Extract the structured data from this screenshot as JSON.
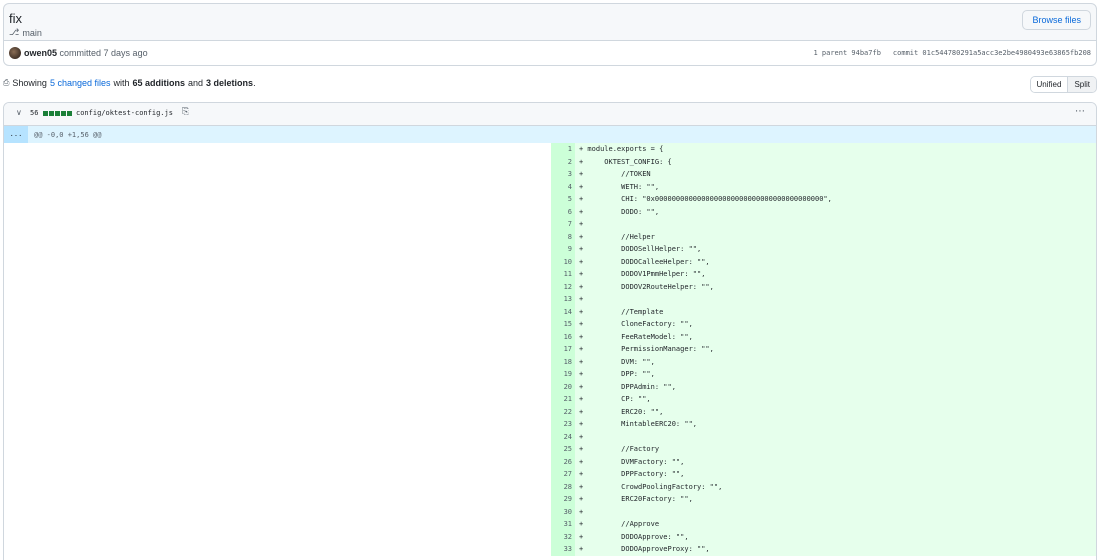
{
  "commit": {
    "title": "fix",
    "branch": "main",
    "browse_label": "Browse files",
    "author": "owen05",
    "committed_text": "committed 7 days ago",
    "parent_text": "1 parent 94ba7fb",
    "commit_text": "commit 01c544780291a5acc3e2be4980493e63865fb208"
  },
  "summary": {
    "showing": "Showing",
    "changed_files": "5 changed files",
    "with": "with",
    "additions": "65 additions",
    "and": "and",
    "deletions": "3 deletions",
    "period": "."
  },
  "view_toggle": {
    "unified": "Unified",
    "split": "Split"
  },
  "file": {
    "count": "56",
    "name": "config/oktest-config.js",
    "expand_label": "...",
    "hunk": "@@ -0,0 +1,56 @@"
  },
  "icons": {
    "branch": "git-branch-icon",
    "file_diff": "file-diff-icon",
    "chevron": "chevron-down-icon",
    "copy": "copy-icon",
    "kebab": "kebab-horizontal-icon"
  },
  "colors": {
    "link": "#0969da",
    "addition_bg": "#e6ffec",
    "addition_num_bg": "#ccffd8",
    "hunk_bg": "#ddf4ff"
  },
  "lines": [
    {
      "n": "1",
      "c": "+ module.exports = {"
    },
    {
      "n": "2",
      "c": "+     OKTEST_CONFIG: {"
    },
    {
      "n": "3",
      "c": "+         //TOKEN"
    },
    {
      "n": "4",
      "c": "+         WETH: \"\","
    },
    {
      "n": "5",
      "c": "+         CHI: \"0x0000000000000000000000000000000000000000\","
    },
    {
      "n": "6",
      "c": "+         DODO: \"\","
    },
    {
      "n": "7",
      "c": "+"
    },
    {
      "n": "8",
      "c": "+         //Helper"
    },
    {
      "n": "9",
      "c": "+         DODOSellHelper: \"\","
    },
    {
      "n": "10",
      "c": "+         DODOCalleeHelper: \"\","
    },
    {
      "n": "11",
      "c": "+         DODOV1PmmHelper: \"\","
    },
    {
      "n": "12",
      "c": "+         DODOV2RouteHelper: \"\","
    },
    {
      "n": "13",
      "c": "+"
    },
    {
      "n": "14",
      "c": "+         //Template"
    },
    {
      "n": "15",
      "c": "+         CloneFactory: \"\","
    },
    {
      "n": "16",
      "c": "+         FeeRateModel: \"\","
    },
    {
      "n": "17",
      "c": "+         PermissionManager: \"\","
    },
    {
      "n": "18",
      "c": "+         DVM: \"\","
    },
    {
      "n": "19",
      "c": "+         DPP: \"\","
    },
    {
      "n": "20",
      "c": "+         DPPAdmin: \"\","
    },
    {
      "n": "21",
      "c": "+         CP: \"\","
    },
    {
      "n": "22",
      "c": "+         ERC20: \"\","
    },
    {
      "n": "23",
      "c": "+         MintableERC20: \"\","
    },
    {
      "n": "24",
      "c": "+"
    },
    {
      "n": "25",
      "c": "+         //Factory"
    },
    {
      "n": "26",
      "c": "+         DVMFactory: \"\","
    },
    {
      "n": "27",
      "c": "+         DPPFactory: \"\","
    },
    {
      "n": "28",
      "c": "+         CrowdPoolingFactory: \"\","
    },
    {
      "n": "29",
      "c": "+         ERC20Factory: \"\","
    },
    {
      "n": "30",
      "c": "+"
    },
    {
      "n": "31",
      "c": "+         //Approve"
    },
    {
      "n": "32",
      "c": "+         DODOApprove: \"\","
    },
    {
      "n": "33",
      "c": "+         DODOApproveProxy: \"\","
    }
  ]
}
